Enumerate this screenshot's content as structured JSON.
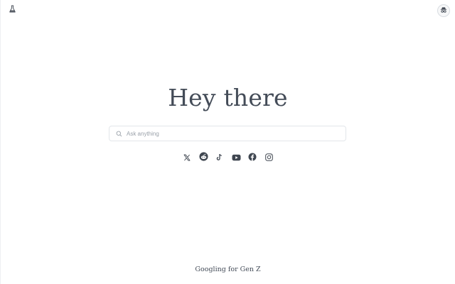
{
  "header": {
    "logo_icon": "flask-icon",
    "avatar_icon": "incognito-icon"
  },
  "main": {
    "title": "Hey there",
    "search": {
      "placeholder": "Ask anything",
      "value": "",
      "icon": "search-icon"
    },
    "socials": [
      {
        "name": "x-icon"
      },
      {
        "name": "reddit-icon"
      },
      {
        "name": "tiktok-icon"
      },
      {
        "name": "youtube-icon"
      },
      {
        "name": "facebook-icon"
      },
      {
        "name": "instagram-icon"
      }
    ]
  },
  "footer": {
    "tagline": "Googling for Gen Z"
  },
  "colors": {
    "text": "#444c58",
    "icon": "#3f4650",
    "border": "#e3e6ea",
    "placeholder": "#9aa1a9"
  }
}
